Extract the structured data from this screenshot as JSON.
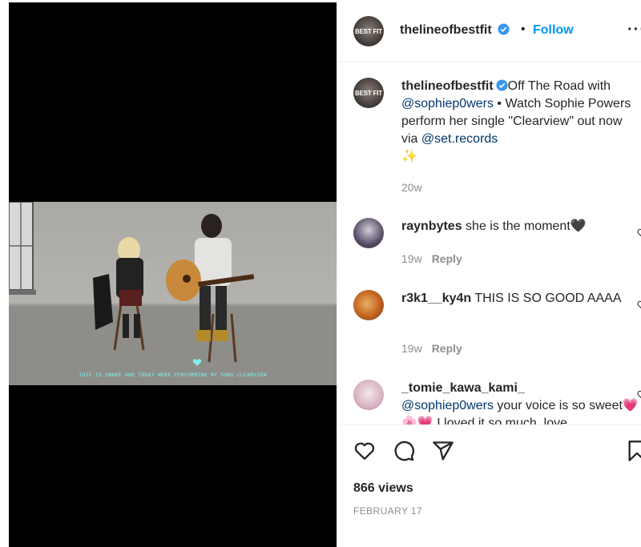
{
  "post": {
    "author": "thelineofbestfit",
    "avatar_text": "BEST FIT",
    "follow_label": "Follow",
    "separator": "•",
    "more_label": "···",
    "caption_parts": {
      "text1": "Off The Road with ",
      "mention1": "@sophiep0wers",
      "text2": " • Watch Sophie Powers perform her single \"Clearview\" out now via ",
      "mention2": "@set.records",
      "emoji": "✨"
    },
    "caption_time": "20w"
  },
  "video": {
    "subtitle": "THIS IS SNAKE AND TODAY WERE PERFORMING MY SONG CLEARVIEW"
  },
  "comments": [
    {
      "user": "raynbytes",
      "text": " she is the moment🖤",
      "time": "19w",
      "reply": "Reply"
    },
    {
      "user": "r3k1__ky4n",
      "text": " THIS IS SO GOOD AAAA",
      "time": "19w",
      "reply": "Reply"
    },
    {
      "user": "_tomie_kawa_kami_",
      "mention": "@sophiep0wers",
      "text": " your voice is so sweet💗🌸💗 I loved it so much, love"
    }
  ],
  "footer": {
    "views": "866 views",
    "date": "FEBRUARY 17"
  },
  "icons": [
    "verified-icon",
    "heart-icon",
    "comment-icon",
    "share-icon",
    "bookmark-icon",
    "more-icon"
  ],
  "colors": {
    "accent": "#0095f6",
    "link": "#00376b",
    "muted": "#8e8e8e",
    "verified": "#3897f0"
  }
}
